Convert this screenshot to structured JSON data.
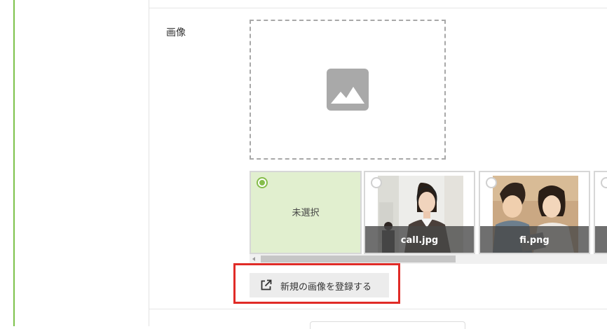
{
  "form": {
    "image_field": {
      "label": "画像",
      "preview": {
        "icon": "image-placeholder-icon"
      }
    },
    "gallery": {
      "items": [
        {
          "label": "未選択",
          "selected": true
        },
        {
          "label": "call.jpg",
          "selected": false
        },
        {
          "label": "fi.png",
          "selected": false
        },
        {
          "label": "",
          "selected": false
        }
      ]
    },
    "register_button": {
      "label": "新規の画像を登録する",
      "icon": "open-in-new-icon"
    }
  },
  "colors": {
    "accent_green": "#7dc24b",
    "selected_bg": "#e1efcf",
    "highlight_red": "#e02b27",
    "button_bg": "#ececec"
  }
}
